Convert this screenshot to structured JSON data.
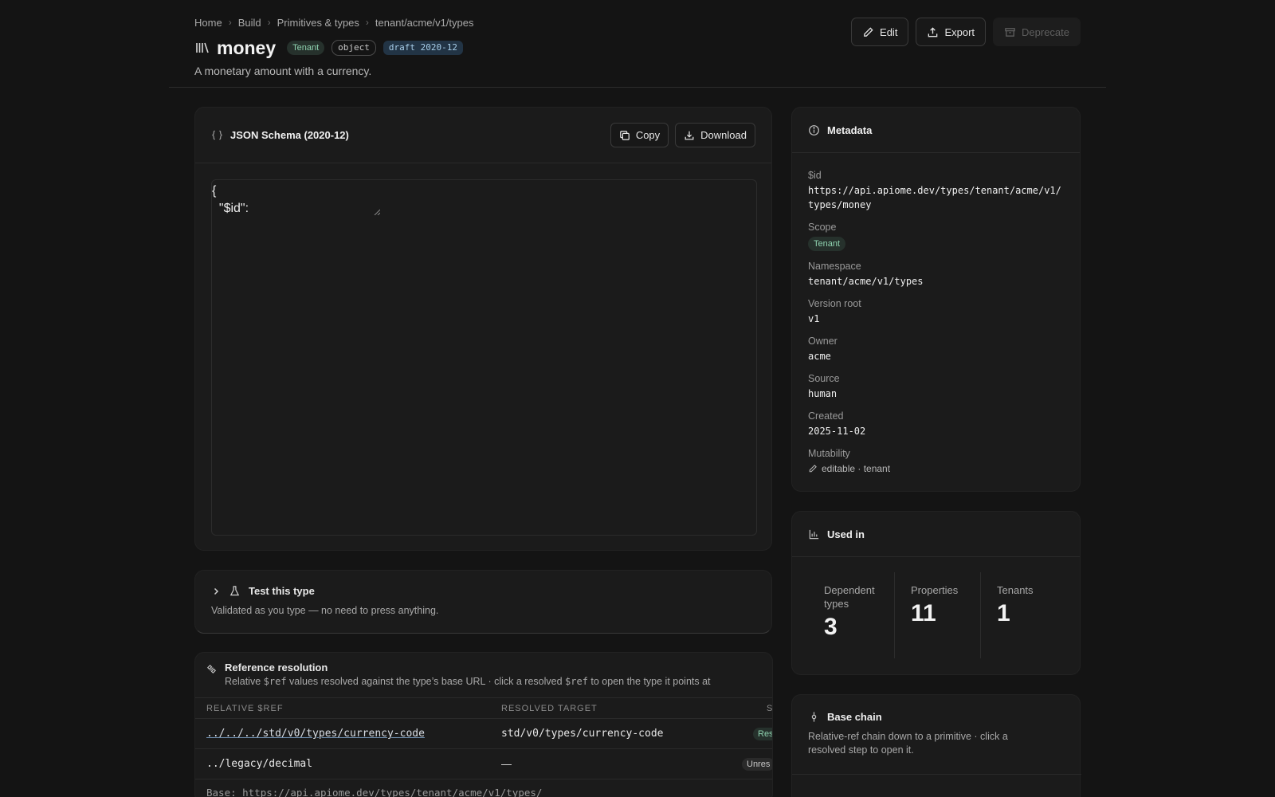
{
  "breadcrumb": [
    "Home",
    "Build",
    "Primitives & types",
    "tenant/acme/v1/types"
  ],
  "header": {
    "title": "money",
    "badges": {
      "scope": "Tenant",
      "kind": "object",
      "draft": "draft 2020-12"
    },
    "description": "A monetary amount with a currency."
  },
  "actions": {
    "edit": "Edit",
    "export": "Export",
    "deprecate": "Deprecate"
  },
  "schema": {
    "title": "JSON Schema (2020-12)",
    "copy": "Copy",
    "download": "Download",
    "editor_text": "{\n  \"$id\":"
  },
  "test": {
    "title": "Test this type",
    "description": "Validated as you type — no need to press anything."
  },
  "references": {
    "title": "Reference resolution",
    "desc_a": "Relative ",
    "desc_code1": "$ref",
    "desc_b": " values resolved against the type’s base URL · click a resolved ",
    "desc_code2": "$ref",
    "desc_c": " to open the type it points at",
    "columns": [
      "RELATIVE $REF",
      "RESOLVED TARGET",
      "S"
    ],
    "rows": [
      {
        "ref": "../../../std/v0/types/currency-code",
        "target": "std/v0/types/currency-code",
        "status": "Res"
      },
      {
        "ref": "../legacy/decimal",
        "target": "—",
        "status": "Unres"
      }
    ],
    "base": "Base: https://api.apiome.dev/types/tenant/acme/v1/types/"
  },
  "metadata": {
    "title": "Metadata",
    "items": {
      "id_label": "$id",
      "id_value": "https://api.apiome.dev/types/tenant/acme/v1/types/money",
      "scope_label": "Scope",
      "scope_value": "Tenant",
      "namespace_label": "Namespace",
      "namespace_value": "tenant/acme/v1/types",
      "version_label": "Version root",
      "version_value": "v1",
      "owner_label": "Owner",
      "owner_value": "acme",
      "source_label": "Source",
      "source_value": "human",
      "created_label": "Created",
      "created_value": "2025-11-02",
      "mutability_label": "Mutability",
      "mutability_value": "editable · tenant"
    }
  },
  "used_in": {
    "title": "Used in",
    "stats": [
      {
        "label": "Dependent types",
        "value": "3"
      },
      {
        "label": "Properties",
        "value": "11"
      },
      {
        "label": "Tenants",
        "value": "1"
      }
    ]
  },
  "base_chain": {
    "title": "Base chain",
    "description": "Relative-ref chain down to a primitive · click a resolved step to open it."
  },
  "icons": {
    "title": "library-icon",
    "edit": "pencil-icon",
    "export": "upload-icon",
    "deprecate": "archive-icon",
    "schema": "braces-icon",
    "copy": "copy-icon",
    "download": "download-icon",
    "test": "flask-icon",
    "references": "link-icon",
    "metadata": "info-icon",
    "used_in": "bar-chart-icon",
    "base_chain": "commit-icon"
  }
}
